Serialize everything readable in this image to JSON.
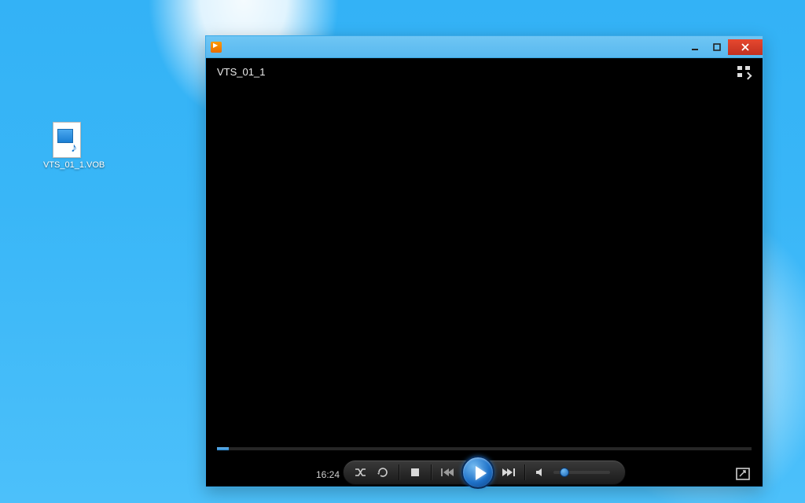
{
  "desktop": {
    "file_label": "VTS_01_1.VOB"
  },
  "player": {
    "title": "",
    "now_playing": "VTS_01_1",
    "elapsed": "16:24",
    "progress_pct": 2.2,
    "icons": {
      "app": "play-square-icon",
      "minimize": "minimize-icon",
      "maximize": "maximize-icon",
      "close": "close-icon",
      "switch_library": "switch-to-library-icon",
      "shuffle": "shuffle-icon",
      "repeat": "repeat-icon",
      "stop": "stop-icon",
      "previous": "previous-icon",
      "play": "play-icon",
      "next": "next-icon",
      "mute": "mute-icon",
      "fullscreen": "fullscreen-icon"
    },
    "colors": {
      "titlebar": "#5fbdf1",
      "close": "#d23b2a",
      "accent": "#2a88d0"
    }
  }
}
